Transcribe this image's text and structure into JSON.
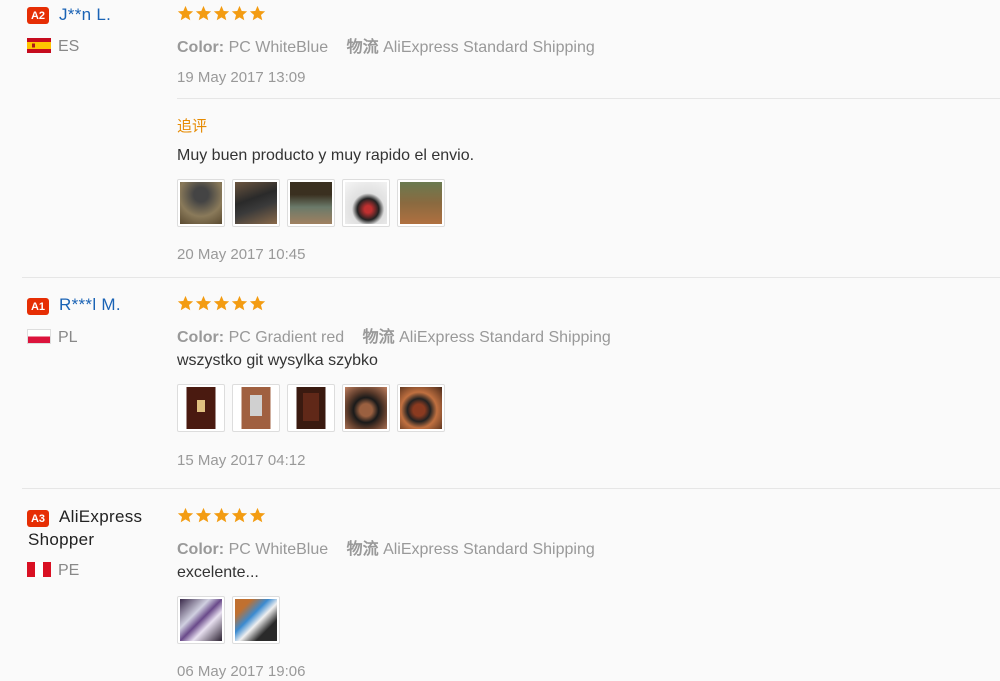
{
  "reviews": [
    {
      "badge": "A2",
      "username": "J**n L.",
      "country": "ES",
      "color_label": "Color:",
      "color_value": "PC WhiteBlue",
      "shipping_label": "物流",
      "shipping_value": "AliExpress Standard Shipping",
      "date": "19 May 2017 13:09",
      "additional_label": "追评",
      "additional_text": "Muy buen producto y muy rapido el envio.",
      "additional_date": "20 May 2017 10:45",
      "rating": 5
    },
    {
      "badge": "A1",
      "username": "R***l M.",
      "country": "PL",
      "color_label": "Color:",
      "color_value": "PC Gradient red",
      "shipping_label": "物流",
      "shipping_value": "AliExpress Standard Shipping",
      "text": "wszystko git wysylka szybko",
      "date": "15 May 2017 04:12",
      "rating": 5
    },
    {
      "badge": "A3",
      "username_line1": "AliExpress",
      "username_line2": "Shopper",
      "country": "PE",
      "color_label": "Color:",
      "color_value": "PC WhiteBlue",
      "shipping_label": "物流",
      "shipping_value": "AliExpress Standard Shipping",
      "text": "excelente...",
      "date": "06 May 2017 19:06",
      "rating": 5
    }
  ],
  "colors": {
    "star": "#f39c12",
    "badge": "#e62e04",
    "username_link": "#1a63b5",
    "additional_label": "#e68a00"
  }
}
